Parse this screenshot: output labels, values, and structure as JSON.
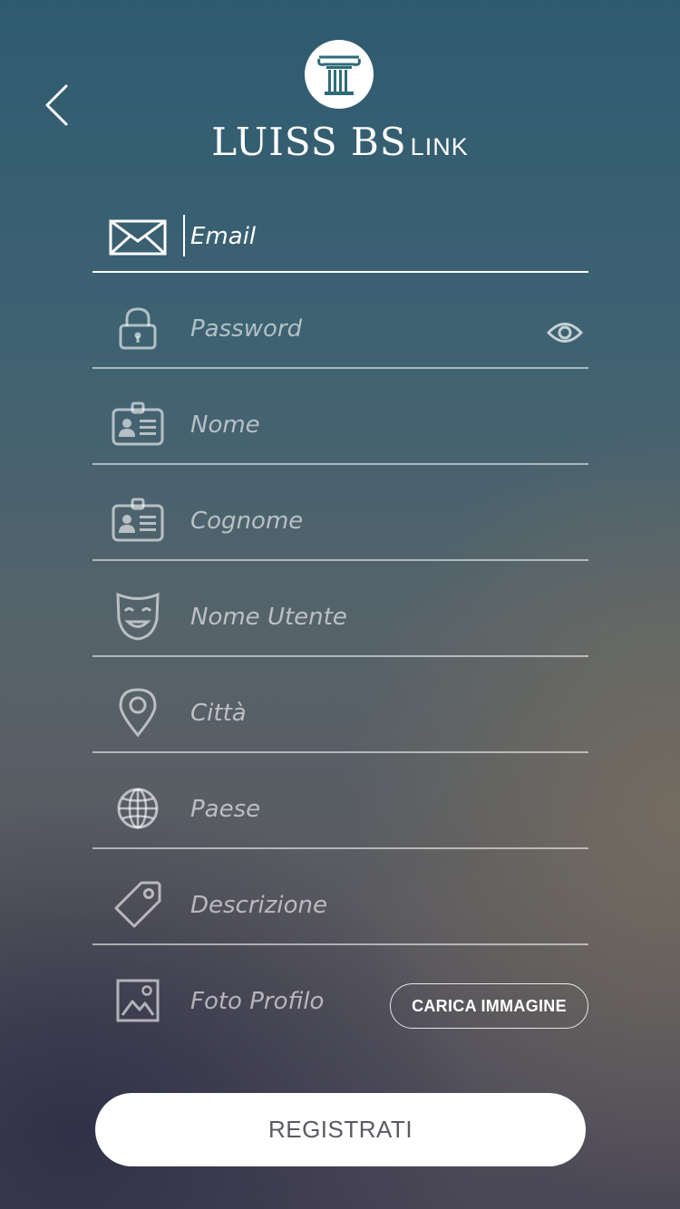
{
  "header": {
    "back_icon": "chevron-left-icon",
    "logo": {
      "main_text": "LUISS BS",
      "sub_text": "LINK",
      "emblem_icon": "column-icon"
    }
  },
  "form": {
    "fields": [
      {
        "id": "email",
        "icon": "envelope-icon",
        "placeholder": "Email",
        "focused": true
      },
      {
        "id": "password",
        "icon": "lock-icon",
        "placeholder": "Password",
        "trailing_icon": "eye-icon"
      },
      {
        "id": "nome",
        "icon": "id-card-icon",
        "placeholder": "Nome"
      },
      {
        "id": "cognome",
        "icon": "id-card-icon",
        "placeholder": "Cognome"
      },
      {
        "id": "nome-utente",
        "icon": "mask-icon",
        "placeholder": "Nome Utente"
      },
      {
        "id": "citta",
        "icon": "map-pin-icon",
        "placeholder": "Città"
      },
      {
        "id": "paese",
        "icon": "globe-icon",
        "placeholder": "Paese"
      },
      {
        "id": "descrizione",
        "icon": "tag-icon",
        "placeholder": "Descrizione"
      }
    ],
    "photo": {
      "icon": "image-icon",
      "placeholder": "Foto Profilo",
      "upload_label": "CARICA IMMAGINE"
    },
    "submit_label": "REGISTRATI"
  },
  "colors": {
    "accent": "#ffffff",
    "logo_emblem": "#2f6b78",
    "button_text": "#5a5a60"
  }
}
